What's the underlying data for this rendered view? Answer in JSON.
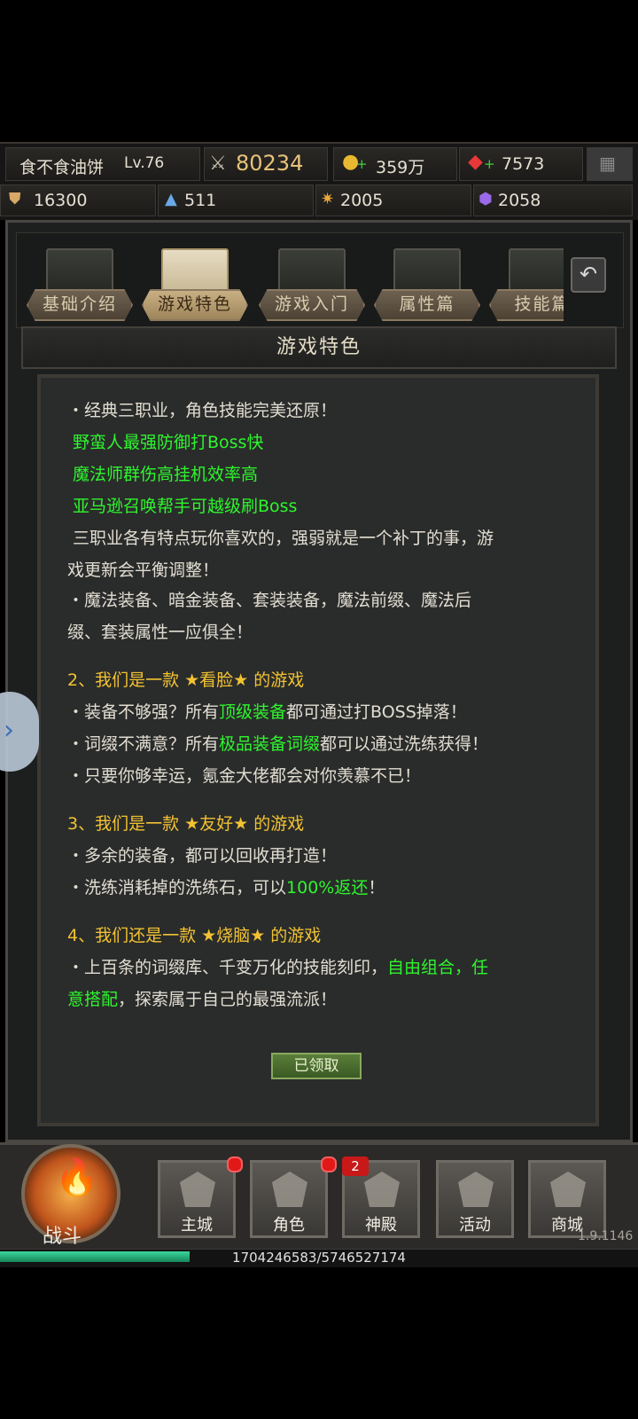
{
  "header": {
    "player_name": "食不食油饼",
    "level": "Lv.76",
    "combat_power": "80234",
    "gold": "359万",
    "gems": "7573",
    "res1": "16300",
    "res2": "511",
    "res3": "2005",
    "res4": "2058"
  },
  "tabs": [
    {
      "label": "基础介绍"
    },
    {
      "label": "游戏特色"
    },
    {
      "label": "游戏入门"
    },
    {
      "label": "属性篇"
    },
    {
      "label": "技能篇"
    }
  ],
  "panel_title": "游戏特色",
  "content": {
    "l1": "・经典三职业，角色技能完美还原！",
    "l2": "野蛮人最强防御打Boss快",
    "l3": "魔法师群伤高挂机效率高",
    "l4": "亚马逊召唤帮手可越级刷Boss",
    "l5": "三职业各有特点玩你喜欢的，强弱就是一个补丁的事，游",
    "l6": "戏更新会平衡调整！",
    "l7": "・魔法装备、暗金装备、套装装备，魔法前缀、魔法后",
    "l8": "缀、套装属性一应俱全！",
    "h2": "2、我们是一款 ★看脸★ 的游戏",
    "l9a": "・装备不够强？所有",
    "l9b": "顶级装备",
    "l9c": "都可通过打BOSS掉落！",
    "l10a": "・词缀不满意？所有",
    "l10b": "极品装备词缀",
    "l10c": "都可以通过洗练获得！",
    "l11": "・只要你够幸运，氪金大佬都会对你羡慕不已！",
    "h3": "3、我们是一款 ★友好★ 的游戏",
    "l12": "・多余的装备，都可以回收再打造！",
    "l13a": "・洗练消耗掉的洗练石，可以",
    "l13b": "100%返还",
    "l13c": "！",
    "h4": "4、我们还是一款 ★烧脑★ 的游戏",
    "l14a": "・上百条的词缀库、千变万化的技能刻印，",
    "l14b": "自由组合，任",
    "l15a": "意搭配",
    "l15b": "，探索属于自己的最强流派！"
  },
  "claim_button": "已领取",
  "nav": {
    "battle": "战斗",
    "items": [
      {
        "label": "主城",
        "icon": "castle-icon"
      },
      {
        "label": "角色",
        "icon": "helmet-icon"
      },
      {
        "label": "神殿",
        "icon": "temple-icon"
      },
      {
        "label": "活动",
        "icon": "banner-icon"
      },
      {
        "label": "商城",
        "icon": "diamond-icon"
      }
    ],
    "temple_badge": "2"
  },
  "version": "1.9.1146",
  "exp": {
    "text": "1704246583/5746527174",
    "progress": 0.297
  },
  "colors": {
    "highlight_green": "#2ef52e",
    "heading_yellow": "#f2c232"
  }
}
